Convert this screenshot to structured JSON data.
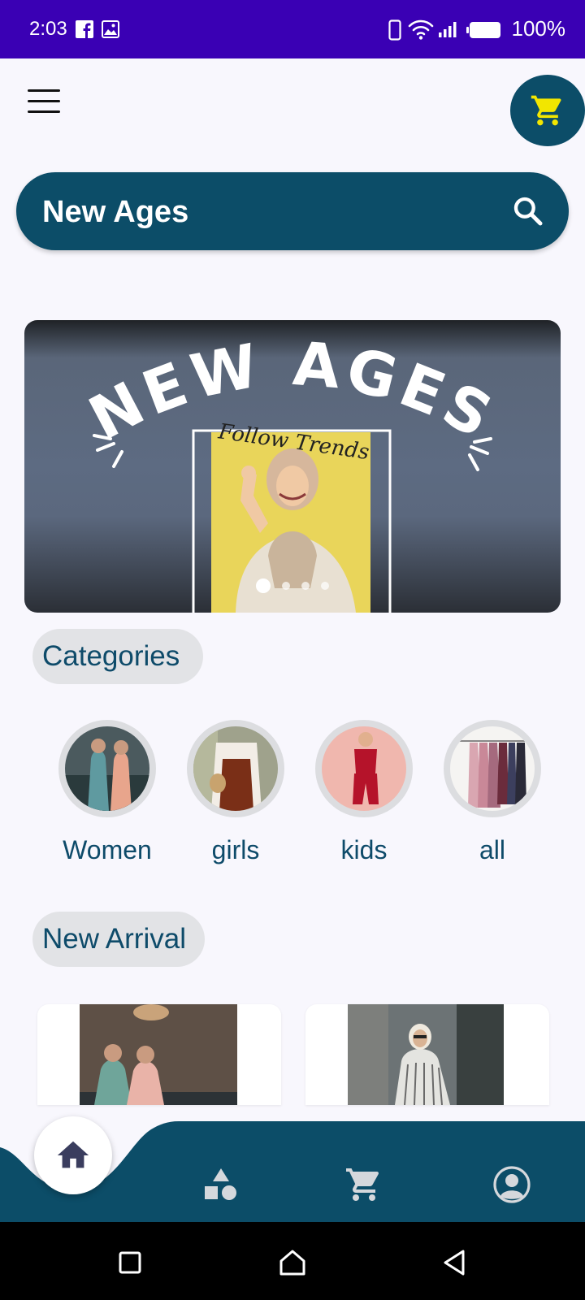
{
  "status_bar": {
    "time": "2:03",
    "battery": "100%"
  },
  "header": {
    "menu_icon": "hamburger-menu-icon",
    "cart_icon": "shopping-cart-icon"
  },
  "search": {
    "brand": "New Ages",
    "icon": "search-icon"
  },
  "banner": {
    "title": "NEW AGES",
    "tagline": "Follow Trends",
    "slides": 4,
    "active_slide": 1
  },
  "sections": {
    "categories": "Categories",
    "new_arrival": "New Arrival"
  },
  "categories": [
    {
      "label": "Women"
    },
    {
      "label": "girls"
    },
    {
      "label": "kids"
    },
    {
      "label": "all"
    }
  ],
  "bottom_nav": {
    "items": [
      "home-icon",
      "shapes-icon",
      "cart-icon",
      "profile-icon"
    ],
    "active": "home"
  },
  "colors": {
    "status_bar": "#3a00b4",
    "primary": "#0c4d68",
    "cart_accent": "#f2e600",
    "text_primary": "#0e4b6a",
    "background": "#f8f7fd"
  }
}
